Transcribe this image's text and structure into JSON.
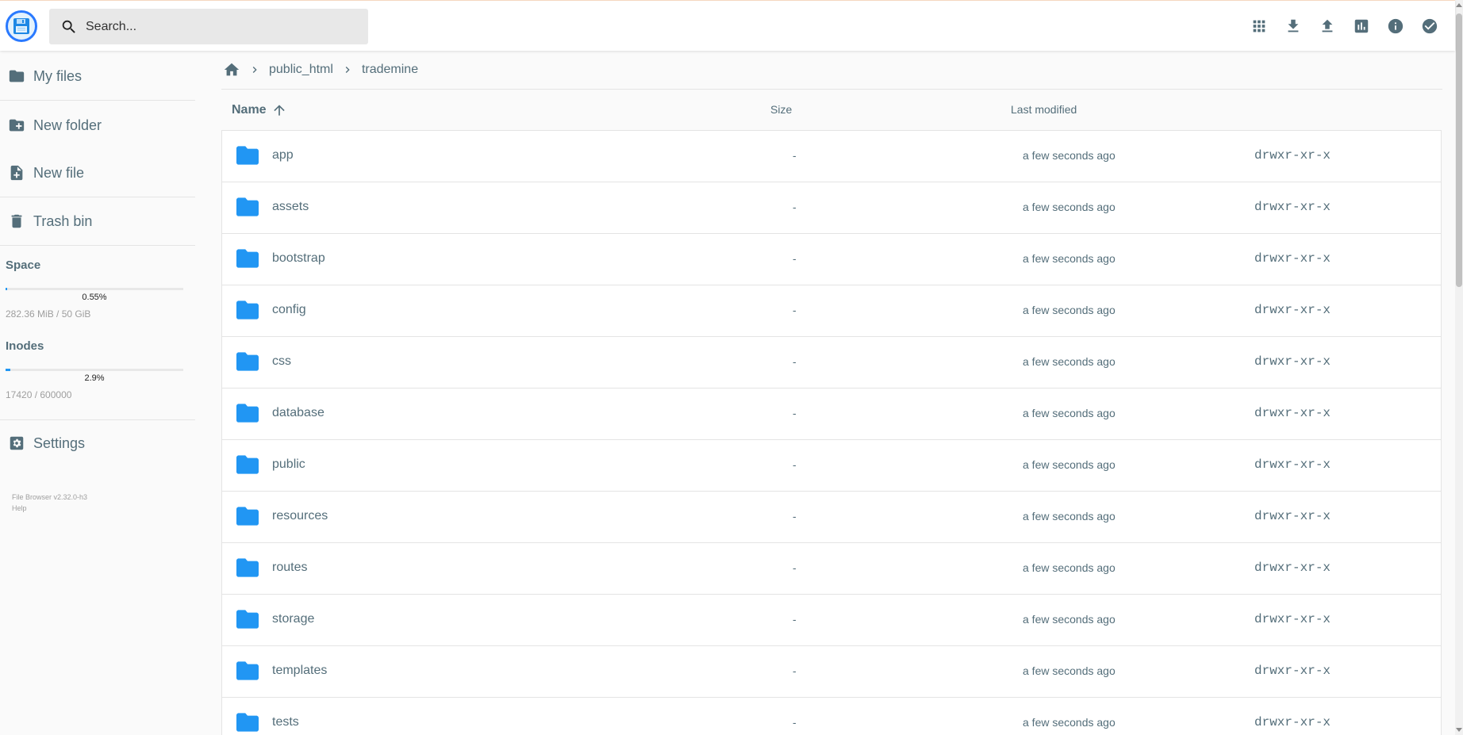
{
  "search": {
    "placeholder": "Search..."
  },
  "sidebar": {
    "items": [
      {
        "label": "My files",
        "icon": "folder-icon"
      },
      {
        "label": "New folder",
        "icon": "create-new-folder-icon"
      },
      {
        "label": "New file",
        "icon": "note-add-icon"
      },
      {
        "label": "Trash bin",
        "icon": "trash-icon"
      }
    ],
    "space": {
      "title": "Space",
      "percent_label": "0.55%",
      "fraction": 0.0055,
      "usage": "282.36 MiB / 50 GiB"
    },
    "inodes": {
      "title": "Inodes",
      "percent_label": "2.9%",
      "fraction": 0.029,
      "usage": "17420 / 600000"
    },
    "settings_label": "Settings",
    "version": "File Browser v2.32.0-h3",
    "help": "Help"
  },
  "header_actions": [
    "grid-view-icon",
    "download-icon",
    "upload-icon",
    "bar-chart-icon",
    "info-icon",
    "check-circle-icon"
  ],
  "breadcrumbs": [
    "public_html",
    "trademine"
  ],
  "columns": {
    "name": "Name",
    "size": "Size",
    "modified": "Last modified"
  },
  "files": [
    {
      "name": "app",
      "size": "-",
      "modified": "a few seconds ago",
      "perm": "drwxr-xr-x"
    },
    {
      "name": "assets",
      "size": "-",
      "modified": "a few seconds ago",
      "perm": "drwxr-xr-x"
    },
    {
      "name": "bootstrap",
      "size": "-",
      "modified": "a few seconds ago",
      "perm": "drwxr-xr-x"
    },
    {
      "name": "config",
      "size": "-",
      "modified": "a few seconds ago",
      "perm": "drwxr-xr-x"
    },
    {
      "name": "css",
      "size": "-",
      "modified": "a few seconds ago",
      "perm": "drwxr-xr-x"
    },
    {
      "name": "database",
      "size": "-",
      "modified": "a few seconds ago",
      "perm": "drwxr-xr-x"
    },
    {
      "name": "public",
      "size": "-",
      "modified": "a few seconds ago",
      "perm": "drwxr-xr-x"
    },
    {
      "name": "resources",
      "size": "-",
      "modified": "a few seconds ago",
      "perm": "drwxr-xr-x"
    },
    {
      "name": "routes",
      "size": "-",
      "modified": "a few seconds ago",
      "perm": "drwxr-xr-x"
    },
    {
      "name": "storage",
      "size": "-",
      "modified": "a few seconds ago",
      "perm": "drwxr-xr-x"
    },
    {
      "name": "templates",
      "size": "-",
      "modified": "a few seconds ago",
      "perm": "drwxr-xr-x"
    },
    {
      "name": "tests",
      "size": "-",
      "modified": "a few seconds ago",
      "perm": "drwxr-xr-x"
    }
  ],
  "colors": {
    "accent": "#2196f3",
    "text": "#546e7a",
    "logo_ring": "#2979ff"
  }
}
